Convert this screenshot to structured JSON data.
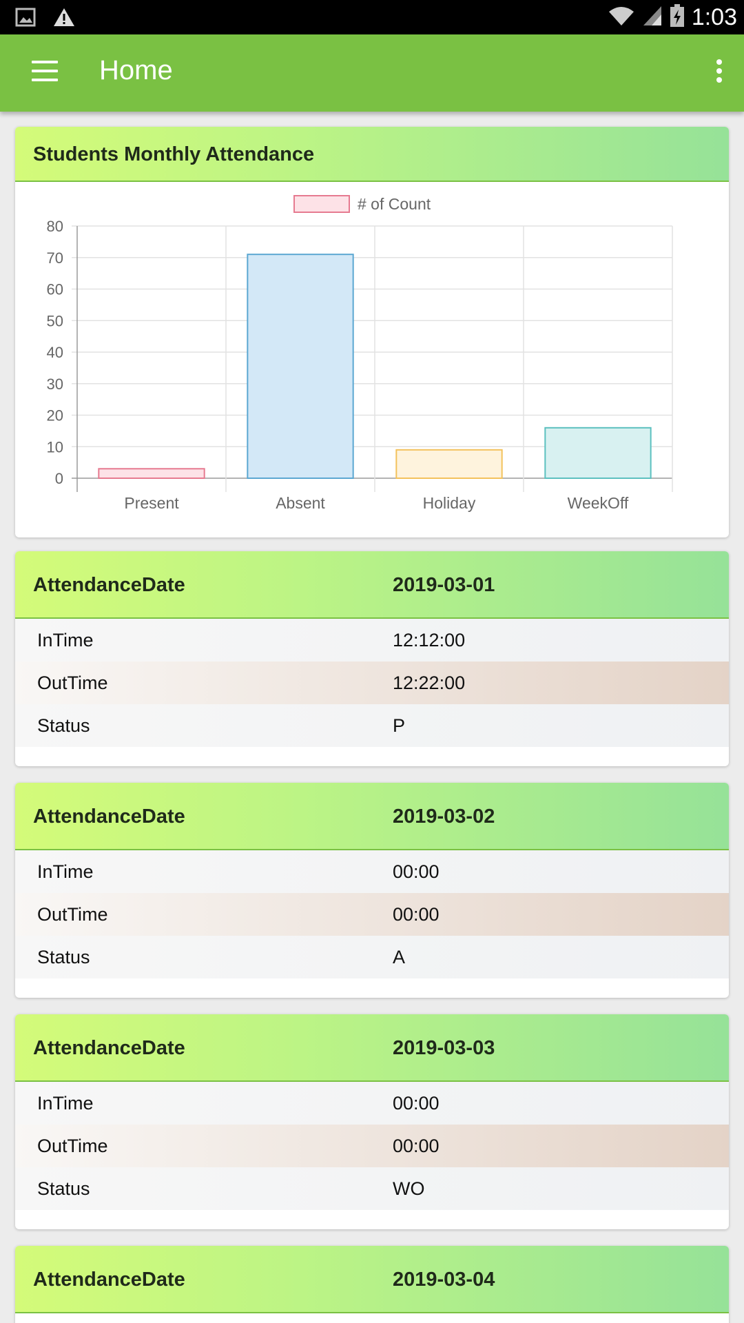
{
  "status_bar": {
    "time": "1:03",
    "icons": [
      "image-icon",
      "warning-icon",
      "wifi-icon",
      "signal-icon",
      "battery-icon"
    ]
  },
  "app_bar": {
    "title": "Home",
    "color": "#7ac143"
  },
  "chart_card": {
    "title": "Students Monthly Attendance"
  },
  "chart_data": {
    "type": "bar",
    "categories": [
      "Present",
      "Absent",
      "Holiday",
      "WeekOff"
    ],
    "series": [
      {
        "name": "# of Count",
        "values": [
          3,
          71,
          9,
          16
        ]
      }
    ],
    "legend": "top",
    "ylim": [
      0,
      80
    ],
    "yticks": [
      0,
      10,
      20,
      30,
      40,
      50,
      60,
      70,
      80
    ],
    "grid": true,
    "bar_colors": [
      {
        "fill": "#fde2e7",
        "stroke": "#e67a90"
      },
      {
        "fill": "#d3e8f7",
        "stroke": "#5ba7d2"
      },
      {
        "fill": "#fef3dd",
        "stroke": "#f3c25c"
      },
      {
        "fill": "#d8f1f1",
        "stroke": "#5cc0bf"
      }
    ],
    "legend_color": {
      "fill": "#fde2e7",
      "stroke": "#e67a90"
    }
  },
  "records": [
    {
      "header_label": "AttendanceDate",
      "date": "2019-03-01",
      "rows": [
        {
          "label": "InTime",
          "value": "12:12:00"
        },
        {
          "label": "OutTime",
          "value": "12:22:00"
        },
        {
          "label": "Status",
          "value": "P"
        }
      ]
    },
    {
      "header_label": "AttendanceDate",
      "date": "2019-03-02",
      "rows": [
        {
          "label": "InTime",
          "value": "00:00"
        },
        {
          "label": "OutTime",
          "value": "00:00"
        },
        {
          "label": "Status",
          "value": "A"
        }
      ]
    },
    {
      "header_label": "AttendanceDate",
      "date": "2019-03-03",
      "rows": [
        {
          "label": "InTime",
          "value": "00:00"
        },
        {
          "label": "OutTime",
          "value": "00:00"
        },
        {
          "label": "Status",
          "value": "WO"
        }
      ]
    },
    {
      "header_label": "AttendanceDate",
      "date": "2019-03-04",
      "rows": []
    }
  ]
}
